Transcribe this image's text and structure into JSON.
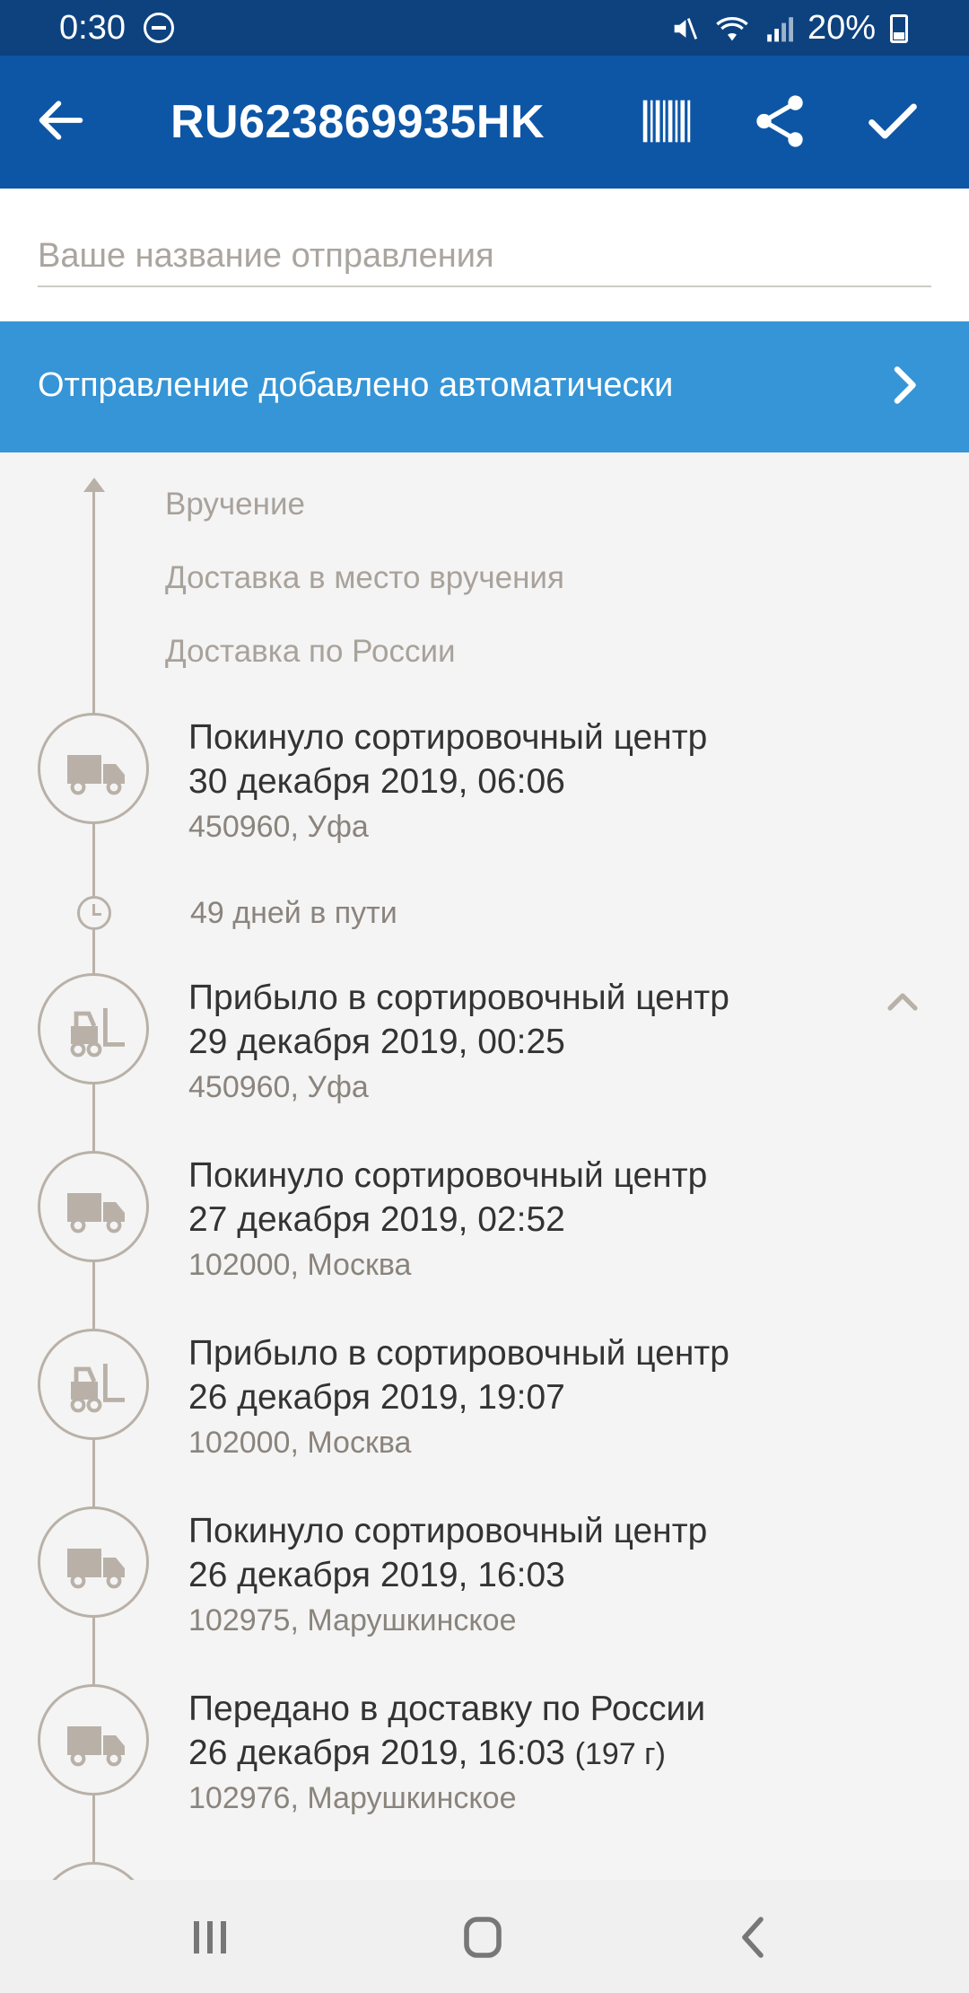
{
  "status_bar": {
    "time": "0:30",
    "battery": "20%",
    "icons": [
      "do-not-disturb-icon",
      "mute-icon",
      "wifi-icon",
      "signal-icon",
      "battery-icon"
    ]
  },
  "app_bar": {
    "title": "RU623869935HK",
    "icons": [
      "back-arrow-icon",
      "barcode-icon",
      "share-icon",
      "check-icon"
    ]
  },
  "name_field": {
    "placeholder": "Ваше название отправления",
    "value": ""
  },
  "banner": {
    "text": "Отправление добавлено автоматически"
  },
  "timeline": {
    "future_steps": [
      "Вручение",
      "Доставка в место вручения",
      "Доставка по России"
    ],
    "transit_text": "49 дней в пути",
    "events": [
      {
        "title": "Покинуло сортировочный центр",
        "date": "30 декабря 2019, 06:06",
        "place": "450960, Уфа",
        "icon": "truck-icon"
      },
      {
        "title": "Прибыло в сортировочный центр",
        "date": "29 декабря 2019, 00:25",
        "place": "450960, Уфа",
        "icon": "forklift-icon"
      },
      {
        "title": "Покинуло сортировочный центр",
        "date": "27 декабря 2019, 02:52",
        "place": "102000, Москва",
        "icon": "truck-icon"
      },
      {
        "title": "Прибыло в сортировочный центр",
        "date": "26 декабря 2019, 19:07",
        "place": "102000, Москва",
        "icon": "forklift-icon"
      },
      {
        "title": "Покинуло сортировочный центр",
        "date": "26 декабря 2019, 16:03",
        "place": "102975, Марушкинское",
        "icon": "truck-icon"
      },
      {
        "title": "Передано в доставку по России",
        "date": "26 декабря 2019, 16:03",
        "weight": "(197 г)",
        "place": "102976, Марушкинское",
        "icon": "truck-icon"
      }
    ]
  },
  "colors": {
    "status_bar": "#0d427f",
    "app_bar": "#0d56a6",
    "banner": "#3595d6",
    "timeline": "#b9b1a8"
  }
}
